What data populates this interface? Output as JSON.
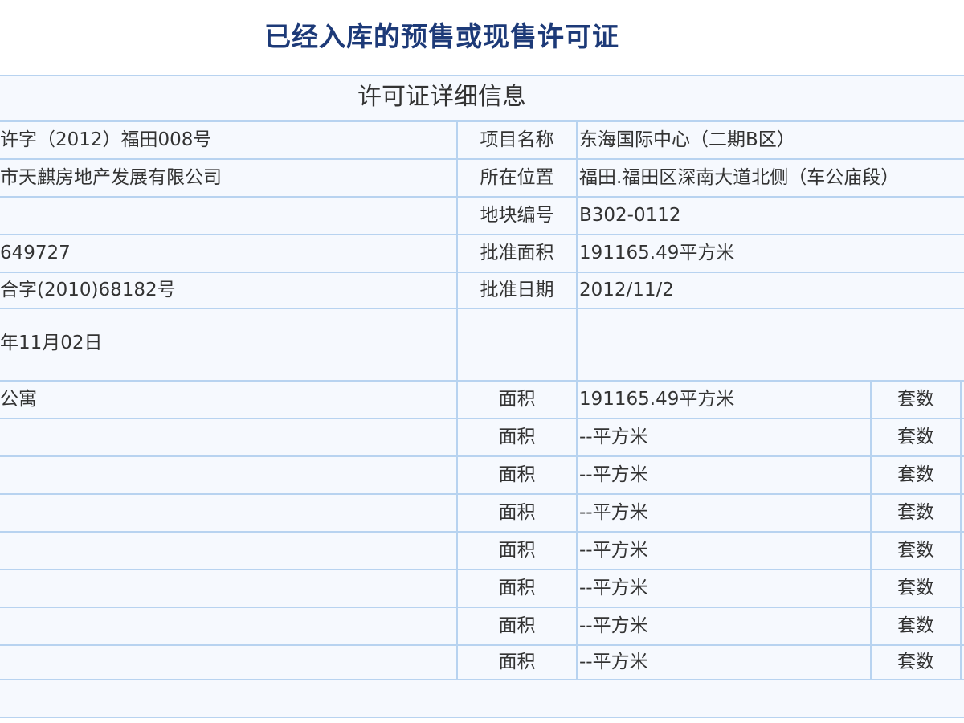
{
  "page_title": "已经入库的预售或现售许可证",
  "section_title": "许可证详细信息",
  "info_rows": [
    {
      "left": "许字（2012）福田008号",
      "label": "项目名称",
      "value": "东海国际中心（二期B区）"
    },
    {
      "left": "市天麒房地产发展有限公司",
      "label": "所在位置",
      "value": "福田.福田区深南大道北侧（车公庙段）"
    },
    {
      "left": "",
      "label": "地块编号",
      "value": "B302-0112"
    },
    {
      "left": "649727",
      "label": "批准面积",
      "value": "191165.49平方米"
    },
    {
      "left": "合字(2010)68182号",
      "label": "批准日期",
      "value": "2012/11/2"
    }
  ],
  "date_row": {
    "left": "年11月02日",
    "label": "",
    "value": ""
  },
  "usage_rows": [
    {
      "left": "公寓",
      "area_label": "面积",
      "area_value": "191165.49平方米",
      "units_label": "套数"
    },
    {
      "left": "",
      "area_label": "面积",
      "area_value": "--平方米",
      "units_label": "套数"
    },
    {
      "left": "",
      "area_label": "面积",
      "area_value": "--平方米",
      "units_label": "套数"
    },
    {
      "left": "",
      "area_label": "面积",
      "area_value": "--平方米",
      "units_label": "套数"
    },
    {
      "left": "",
      "area_label": "面积",
      "area_value": "--平方米",
      "units_label": "套数"
    },
    {
      "left": "",
      "area_label": "面积",
      "area_value": "--平方米",
      "units_label": "套数"
    },
    {
      "left": "",
      "area_label": "面积",
      "area_value": "--平方米",
      "units_label": "套数"
    },
    {
      "left": "",
      "area_label": "面积",
      "area_value": "--平方米",
      "units_label": "套数"
    }
  ],
  "colors": {
    "title": "#1d3a78",
    "border": "#b8d3f0",
    "background": "#f6f9fe",
    "text": "#333333"
  }
}
